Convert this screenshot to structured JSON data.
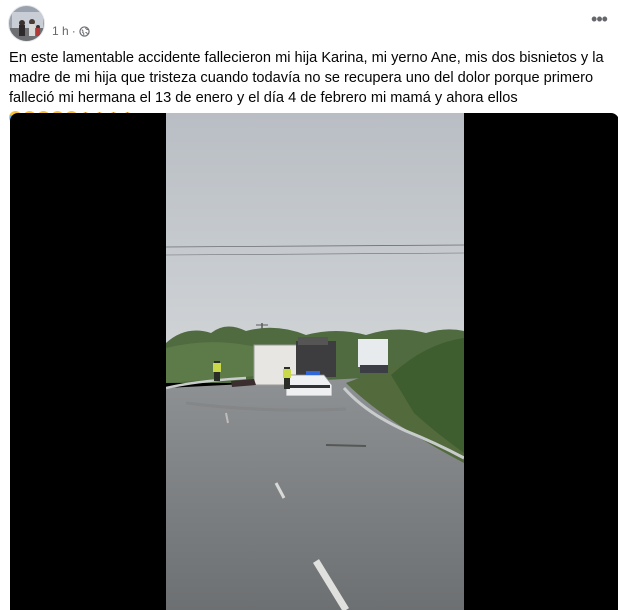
{
  "post": {
    "time": "1 h",
    "separator": "·",
    "privacy_icon": "globe-icon",
    "more_icon": "more-options-icon",
    "text": "En este lamentable accidente fallecieron mi hija Karina, mi yerno Ane, mis dos bisnietos y la madre de mi hija que tristeza cuando todavía no se recupera uno del dolor porque primero falleció mi hermana el 13 de enero y el día 4 de febrero mi mamá y ahora ellos",
    "emojis": [
      "crying-face",
      "crying-face",
      "crying-face",
      "crying-face",
      "crying-face",
      "praying-hands",
      "praying-hands",
      "praying-hands",
      "praying-hands"
    ]
  },
  "video": {
    "description": "roadside crash scene with overturned bus and police car"
  },
  "colors": {
    "text": "#050505",
    "meta": "#65676b",
    "video_bg": "#000000"
  }
}
